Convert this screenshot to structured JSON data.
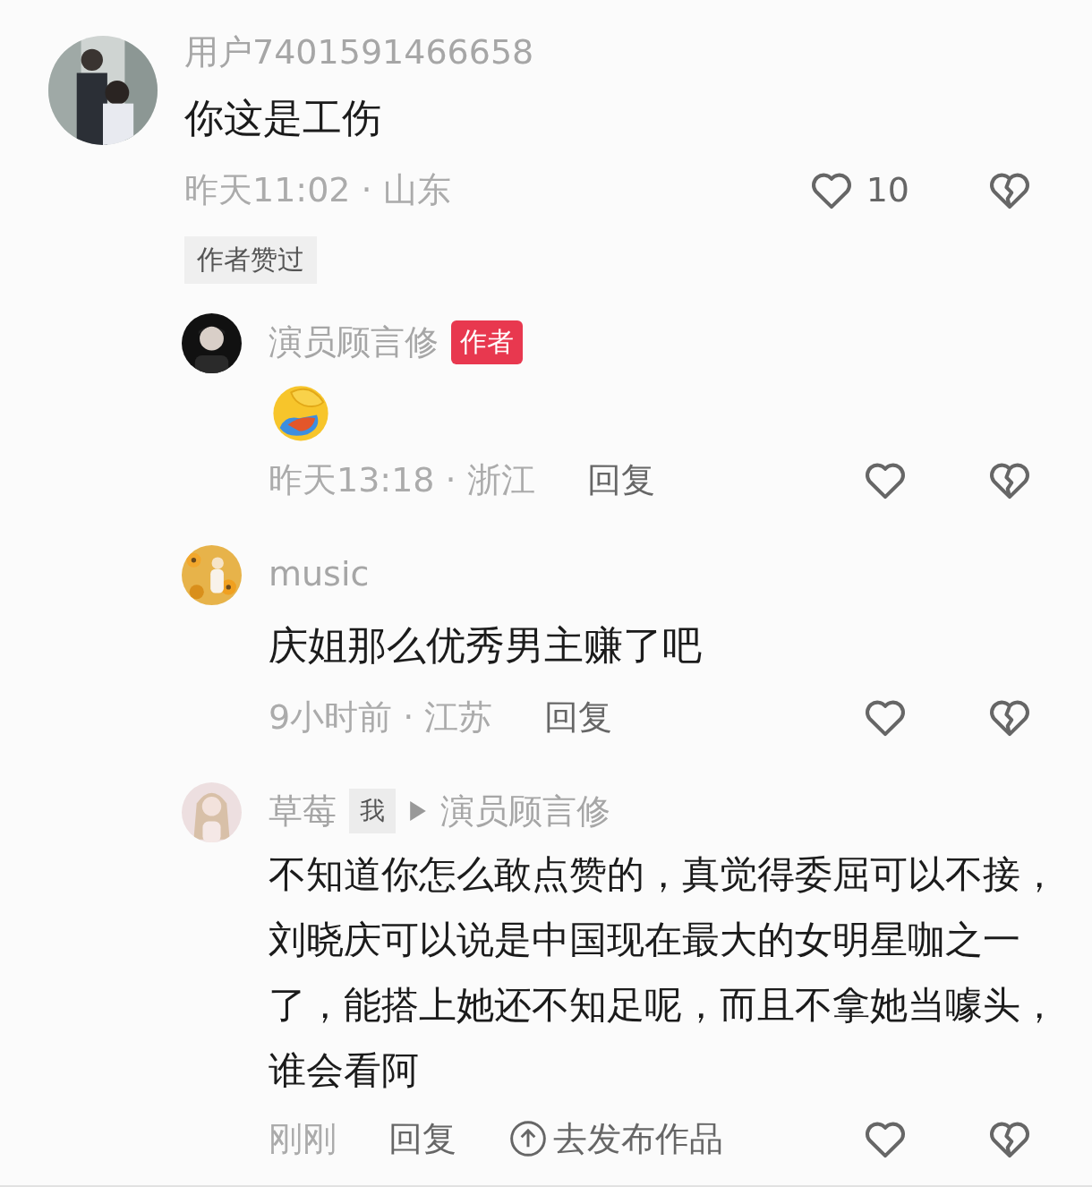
{
  "comments": [
    {
      "kind": "top",
      "username": "用户7401591466658",
      "text": "你这是工伤",
      "meta": "昨天11:02 · 山东",
      "likes": "10",
      "tag": "作者赞过"
    },
    {
      "kind": "reply",
      "username": "演员顾言修",
      "author_badge": "作者",
      "body": {
        "kind": "emoji"
      },
      "meta": "昨天13:18 · 浙江",
      "reply_label": "回复"
    },
    {
      "kind": "reply",
      "username": "music",
      "body": {
        "kind": "text",
        "text": "庆姐那么优秀男主赚了吧"
      },
      "meta": "9小时前 · 江苏",
      "reply_label": "回复"
    },
    {
      "kind": "reply",
      "username": "草莓",
      "me_tag": "我",
      "reply_to": "演员顾言修",
      "body": {
        "kind": "text",
        "text": "不知道你怎么敢点赞的，真觉得委屈可以不接，刘晓庆可以说是中国现在最大的女明星咖之一了，能搭上她还不知足呢，而且不拿她当噱头，谁会看阿"
      },
      "meta": "刚刚",
      "reply_label": "回复",
      "publish_label": "去发布作品"
    }
  ]
}
